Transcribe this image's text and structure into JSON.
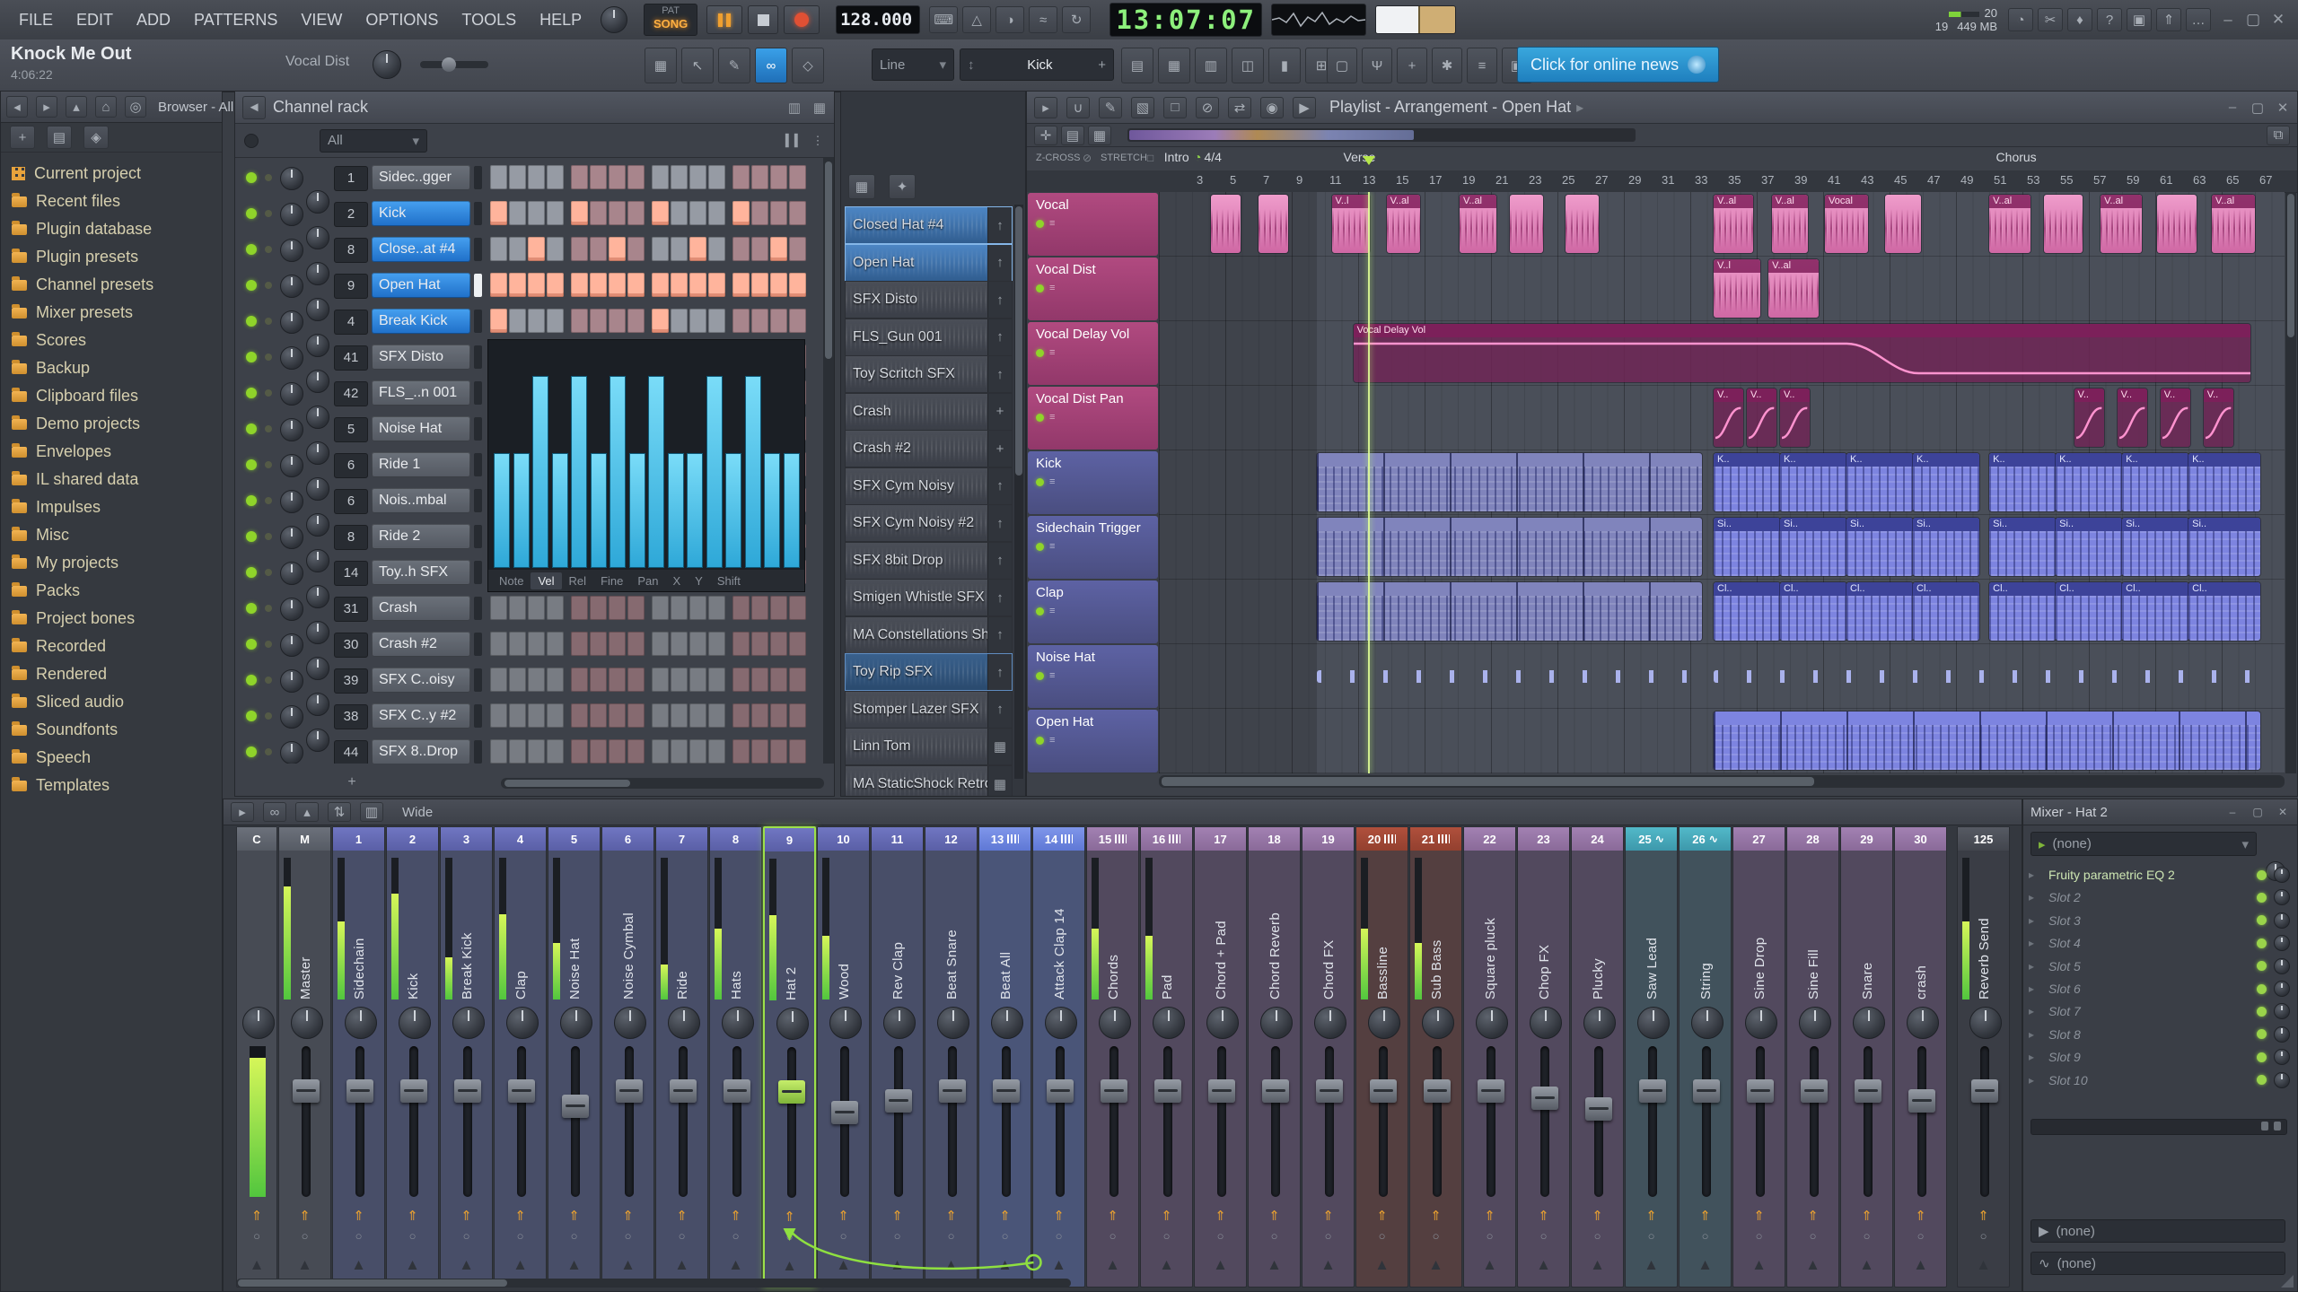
{
  "menubar": {
    "items": [
      "FILE",
      "EDIT",
      "ADD",
      "PATTERNS",
      "VIEW",
      "OPTIONS",
      "TOOLS",
      "HELP"
    ]
  },
  "transport": {
    "pat_label": "PAT",
    "song_label": "SONG",
    "tempo": "128.000",
    "time": "13:07:07",
    "cpu": "20",
    "memory": "449 MB",
    "voices": "19",
    "icons_left": [
      "typing-to-piano",
      "metronome",
      "wait",
      "blend",
      "overdub"
    ],
    "icons_right": [
      "time",
      "cut",
      "mic",
      "help",
      "save",
      "export",
      "chat"
    ]
  },
  "toolbar": {
    "project_title": "Knock Me Out",
    "project_length": "4:06:22",
    "focused_name": "Vocal Dist",
    "snap": "Line",
    "pattern": "Kick",
    "news": "Click for online news",
    "edit_icons": [
      "step-edit",
      "arrow",
      "pencil",
      "link",
      "remote"
    ],
    "view_icons": [
      "playlist",
      "piano-roll",
      "channel-rack",
      "browser-view",
      "mixer-view",
      "plugins"
    ],
    "tool_icons": [
      "clipboard",
      "splitter",
      "touch",
      "tools",
      "macro",
      "console"
    ]
  },
  "window": {
    "controls": [
      "minimize",
      "maximize",
      "close"
    ]
  },
  "browser": {
    "title": "Browser - All",
    "nav_icons": [
      "back",
      "forward",
      "up",
      "home",
      "search"
    ],
    "action_icons": [
      "add",
      "file",
      "autoplay"
    ],
    "items": [
      {
        "label": "Current project",
        "icon": "grid"
      },
      {
        "label": "Recent files",
        "icon": "folder"
      },
      {
        "label": "Plugin database",
        "icon": "folder"
      },
      {
        "label": "Plugin presets",
        "icon": "folder"
      },
      {
        "label": "Channel presets",
        "icon": "folder"
      },
      {
        "label": "Mixer presets",
        "icon": "folder"
      },
      {
        "label": "Scores",
        "icon": "folder"
      },
      {
        "label": "Backup",
        "icon": "folder"
      },
      {
        "label": "Clipboard files",
        "icon": "folder"
      },
      {
        "label": "Demo projects",
        "icon": "folder"
      },
      {
        "label": "Envelopes",
        "icon": "folder"
      },
      {
        "label": "IL shared data",
        "icon": "folder"
      },
      {
        "label": "Impulses",
        "icon": "folder"
      },
      {
        "label": "Misc",
        "icon": "folder"
      },
      {
        "label": "My projects",
        "icon": "folder"
      },
      {
        "label": "Packs",
        "icon": "folder"
      },
      {
        "label": "Project bones",
        "icon": "folder"
      },
      {
        "label": "Recorded",
        "icon": "folder"
      },
      {
        "label": "Rendered",
        "icon": "folder"
      },
      {
        "label": "Sliced audio",
        "icon": "folder"
      },
      {
        "label": "Soundfonts",
        "icon": "folder"
      },
      {
        "label": "Speech",
        "icon": "folder"
      },
      {
        "label": "Templates",
        "icon": "folder"
      }
    ]
  },
  "channel_rack": {
    "title": "Channel rack",
    "filter": "All",
    "graph_tabs": [
      "Note",
      "Vel",
      "Rel",
      "Fine",
      "Pan",
      "X",
      "Y",
      "Shift"
    ],
    "active_tab": "Vel",
    "graph_values": [
      55,
      55,
      92,
      55,
      92,
      55,
      92,
      55,
      92,
      55,
      55,
      92,
      55,
      92,
      55,
      55
    ],
    "channels": [
      {
        "num": "1",
        "name": "Sidec..gger",
        "style": "gray",
        "steps": "0000000000000000"
      },
      {
        "num": "2",
        "name": "Kick",
        "style": "blue",
        "steps": "1000100010001000"
      },
      {
        "num": "8",
        "name": "Close..at #4",
        "style": "blue",
        "steps": "0010001000100010"
      },
      {
        "num": "9",
        "name": "Open Hat",
        "style": "blue",
        "selected": true,
        "steps": "1111111111111111"
      },
      {
        "num": "4",
        "name": "Break Kick",
        "style": "blue",
        "steps": "1000000010000000"
      },
      {
        "num": "41",
        "name": "SFX Disto",
        "style": "gray",
        "steps": "0000000000000000"
      },
      {
        "num": "42",
        "name": "FLS_..n 001",
        "style": "gray",
        "steps": "0000000000000000"
      },
      {
        "num": "5",
        "name": "Noise Hat",
        "style": "gray",
        "steps": "0000000000000000"
      },
      {
        "num": "6",
        "name": "Ride 1",
        "style": "gray",
        "steps": "0000000000000000"
      },
      {
        "num": "6",
        "name": "Nois..mbal",
        "style": "gray",
        "steps": "0000000000000000"
      },
      {
        "num": "8",
        "name": "Ride 2",
        "style": "gray",
        "steps": "0000000000000000"
      },
      {
        "num": "14",
        "name": "Toy..h SFX",
        "style": "gray",
        "steps": "0000000000000000"
      },
      {
        "num": "31",
        "name": "Crash",
        "style": "gray",
        "dim": true,
        "steps": "0000000000000000"
      },
      {
        "num": "30",
        "name": "Crash #2",
        "style": "gray",
        "dim": true,
        "steps": "0000000000000000"
      },
      {
        "num": "39",
        "name": "SFX C..oisy",
        "style": "gray",
        "dim": true,
        "steps": "0000000000000000"
      },
      {
        "num": "38",
        "name": "SFX C..y #2",
        "style": "gray",
        "dim": true,
        "steps": "0000000000000000"
      },
      {
        "num": "44",
        "name": "SFX 8..Drop",
        "style": "gray",
        "dim": true,
        "steps": "0000000000000000"
      }
    ]
  },
  "picker": {
    "panel_icons": [
      "steps",
      "controls"
    ],
    "items": [
      {
        "name": "Closed Hat #4",
        "icon": "arrow",
        "state": "selected"
      },
      {
        "name": "Open Hat",
        "icon": "arrow",
        "state": "selected"
      },
      {
        "name": "SFX Disto",
        "icon": "arrow"
      },
      {
        "name": "FLS_Gun 001",
        "icon": "arrow"
      },
      {
        "name": "Toy Scritch SFX",
        "icon": "arrow"
      },
      {
        "name": "Crash",
        "icon": "move"
      },
      {
        "name": "Crash #2",
        "icon": "move"
      },
      {
        "name": "SFX Cym Noisy",
        "icon": "arrow"
      },
      {
        "name": "SFX Cym Noisy #2",
        "icon": "arrow"
      },
      {
        "name": "SFX 8bit Drop",
        "icon": "arrow"
      },
      {
        "name": "Smigen Whistle SFX",
        "icon": "arrow"
      },
      {
        "name": "MA Constellations Sh..",
        "icon": "arrow"
      },
      {
        "name": "Toy Rip SFX",
        "icon": "arrow",
        "state": "active"
      },
      {
        "name": "Stomper Lazer SFX",
        "icon": "arrow"
      },
      {
        "name": "Linn Tom",
        "icon": "grid"
      },
      {
        "name": "MA StaticShock Retro..",
        "icon": "grid"
      }
    ]
  },
  "playlist": {
    "title": "Playlist - Arrangement - Open Hat",
    "header_icons": [
      "collapse",
      "magnet",
      "pencil",
      "paint",
      "erase",
      "mute",
      "slip",
      "zoom",
      "playback"
    ],
    "zcross_label": "Z-CROSS",
    "stretch_label": "STRETCH",
    "markers": [
      {
        "label": "Intro",
        "bar": 1.2
      },
      {
        "label": "4/4",
        "bar": 3.0,
        "kind": "timesig"
      },
      {
        "label": "Verse",
        "bar": 12.0
      },
      {
        "label": "Chorus",
        "bar": 51.3
      }
    ],
    "bar_numbers": [
      3,
      5,
      7,
      9,
      11,
      13,
      15,
      17,
      19,
      21,
      23,
      25,
      27,
      29,
      31,
      33,
      35,
      37,
      39,
      41,
      43,
      45,
      47,
      49,
      51,
      53,
      55,
      57,
      59,
      61,
      63,
      65,
      67
    ],
    "playhead_bar": 13.5,
    "tracks": [
      {
        "name": "Vocal",
        "color": "pink"
      },
      {
        "name": "Vocal Dist",
        "color": "pink"
      },
      {
        "name": "Vocal Delay Vol",
        "color": "pink"
      },
      {
        "name": "Vocal Dist Pan",
        "color": "pink"
      },
      {
        "name": "Kick",
        "color": "blue"
      },
      {
        "name": "Sidechain Trigger",
        "color": "blue"
      },
      {
        "name": "Clap",
        "color": "blue"
      },
      {
        "name": "Noise Hat",
        "color": "blue"
      },
      {
        "name": "Open Hat",
        "color": "blue"
      }
    ],
    "clips": [
      {
        "t": 0,
        "b": 4.0,
        "l": 1.8,
        "k": "audio"
      },
      {
        "t": 0,
        "b": 6.9,
        "l": 1.8,
        "k": "audio"
      },
      {
        "t": 0,
        "b": 11.3,
        "l": 2.3,
        "k": "audio",
        "label": "V..l"
      },
      {
        "t": 0,
        "b": 14.6,
        "l": 2.0,
        "k": "audio",
        "label": "V..al"
      },
      {
        "t": 0,
        "b": 19.0,
        "l": 2.2,
        "k": "audio",
        "label": "V..al"
      },
      {
        "t": 0,
        "b": 22.0,
        "l": 2.0,
        "k": "audio"
      },
      {
        "t": 0,
        "b": 25.4,
        "l": 2.0,
        "k": "audio"
      },
      {
        "t": 0,
        "b": 34.3,
        "l": 2.4,
        "k": "audio",
        "label": "V..al"
      },
      {
        "t": 0,
        "b": 37.8,
        "l": 2.2,
        "k": "audio",
        "label": "V..al"
      },
      {
        "t": 0,
        "b": 41.0,
        "l": 2.6,
        "k": "audio",
        "label": "Vocal"
      },
      {
        "t": 0,
        "b": 44.6,
        "l": 2.2,
        "k": "audio"
      },
      {
        "t": 0,
        "b": 50.9,
        "l": 2.5,
        "k": "audio",
        "label": "V..al"
      },
      {
        "t": 0,
        "b": 54.2,
        "l": 2.3,
        "k": "audio"
      },
      {
        "t": 0,
        "b": 57.6,
        "l": 2.5,
        "k": "audio",
        "label": "V..al"
      },
      {
        "t": 0,
        "b": 61.0,
        "l": 2.4,
        "k": "audio"
      },
      {
        "t": 0,
        "b": 64.3,
        "l": 2.6,
        "k": "audio",
        "label": "V..al"
      },
      {
        "t": 1,
        "b": 34.3,
        "l": 2.8,
        "k": "audio",
        "label": "V..l"
      },
      {
        "t": 1,
        "b": 37.6,
        "l": 3.0,
        "k": "audio",
        "label": "V..al"
      },
      {
        "t": 2,
        "b": 12.6,
        "l": 54.0,
        "k": "autolong",
        "label": "Vocal Delay Vol"
      },
      {
        "t": 3,
        "b": 34.3,
        "l": 1.8,
        "k": "auto",
        "label": "V.."
      },
      {
        "t": 3,
        "b": 36.3,
        "l": 1.8,
        "k": "auto",
        "label": "V.."
      },
      {
        "t": 3,
        "b": 38.3,
        "l": 1.8,
        "k": "auto",
        "label": "V.."
      },
      {
        "t": 3,
        "b": 56.0,
        "l": 1.8,
        "k": "auto",
        "label": "V.."
      },
      {
        "t": 3,
        "b": 58.6,
        "l": 1.8,
        "k": "auto",
        "label": "V.."
      },
      {
        "t": 3,
        "b": 61.2,
        "l": 1.8,
        "k": "auto",
        "label": "V.."
      },
      {
        "t": 3,
        "b": 63.8,
        "l": 1.8,
        "k": "auto",
        "label": "V.."
      },
      {
        "t": 4,
        "b": 10.4,
        "l": 23.2,
        "k": "patdim"
      },
      {
        "t": 4,
        "b": 34.3,
        "l": 4,
        "k": "pat",
        "label": "K.."
      },
      {
        "t": 4,
        "b": 38.3,
        "l": 4,
        "k": "pat",
        "label": "K.."
      },
      {
        "t": 4,
        "b": 42.3,
        "l": 4,
        "k": "pat",
        "label": "K.."
      },
      {
        "t": 4,
        "b": 46.3,
        "l": 4,
        "k": "pat",
        "label": "K.."
      },
      {
        "t": 4,
        "b": 50.9,
        "l": 4,
        "k": "pat",
        "label": "K.."
      },
      {
        "t": 4,
        "b": 54.9,
        "l": 4,
        "k": "pat",
        "label": "K.."
      },
      {
        "t": 4,
        "b": 58.9,
        "l": 4,
        "k": "pat",
        "label": "K.."
      },
      {
        "t": 4,
        "b": 62.9,
        "l": 4.3,
        "k": "pat",
        "label": "K.."
      },
      {
        "t": 5,
        "b": 10.4,
        "l": 23.2,
        "k": "patdim"
      },
      {
        "t": 5,
        "b": 34.3,
        "l": 4,
        "k": "pat",
        "label": "Si.."
      },
      {
        "t": 5,
        "b": 38.3,
        "l": 4,
        "k": "pat",
        "label": "Si.."
      },
      {
        "t": 5,
        "b": 42.3,
        "l": 4,
        "k": "pat",
        "label": "Si.."
      },
      {
        "t": 5,
        "b": 46.3,
        "l": 4,
        "k": "pat",
        "label": "Si.."
      },
      {
        "t": 5,
        "b": 50.9,
        "l": 4,
        "k": "pat",
        "label": "Si.."
      },
      {
        "t": 5,
        "b": 54.9,
        "l": 4,
        "k": "pat",
        "label": "Si.."
      },
      {
        "t": 5,
        "b": 58.9,
        "l": 4,
        "k": "pat",
        "label": "Si.."
      },
      {
        "t": 5,
        "b": 62.9,
        "l": 4.3,
        "k": "pat",
        "label": "Si.."
      },
      {
        "t": 6,
        "b": 10.4,
        "l": 23.2,
        "k": "patdim"
      },
      {
        "t": 6,
        "b": 34.3,
        "l": 4,
        "k": "pat",
        "label": "Cl.."
      },
      {
        "t": 6,
        "b": 38.3,
        "l": 4,
        "k": "pat",
        "label": "Cl.."
      },
      {
        "t": 6,
        "b": 42.3,
        "l": 4,
        "k": "pat",
        "label": "Cl.."
      },
      {
        "t": 6,
        "b": 46.3,
        "l": 4,
        "k": "pat",
        "label": "Cl.."
      },
      {
        "t": 6,
        "b": 50.9,
        "l": 4,
        "k": "pat",
        "label": "Cl.."
      },
      {
        "t": 6,
        "b": 54.9,
        "l": 4,
        "k": "pat",
        "label": "Cl.."
      },
      {
        "t": 6,
        "b": 58.9,
        "l": 4,
        "k": "pat",
        "label": "Cl.."
      },
      {
        "t": 6,
        "b": 62.9,
        "l": 4.3,
        "k": "pat",
        "label": "Cl.."
      },
      {
        "t": 7,
        "b": 10.4,
        "l": 23.2,
        "k": "ticks"
      },
      {
        "t": 7,
        "b": 34.3,
        "l": 32.9,
        "k": "ticks"
      },
      {
        "t": 8,
        "b": 34.3,
        "l": 32.9,
        "k": "patlong"
      }
    ]
  },
  "mixer": {
    "mode": "Wide",
    "header_icons": [
      "collapse",
      "link",
      "up",
      "updown",
      "film"
    ],
    "strips": [
      {
        "num": "C",
        "name": "",
        "group": "plain",
        "mainMeter": 0.92
      },
      {
        "num": "M",
        "name": "Master",
        "group": "plain",
        "meter": 0.8
      },
      {
        "num": "1",
        "name": "Sidechain",
        "group": "indigo",
        "meter": 0.55
      },
      {
        "num": "2",
        "name": "Kick",
        "group": "indigo",
        "meter": 0.75
      },
      {
        "num": "3",
        "name": "Break Kick",
        "group": "indigo",
        "meter": 0.3
      },
      {
        "num": "4",
        "name": "Clap",
        "group": "indigo",
        "meter": 0.6
      },
      {
        "num": "5",
        "name": "Noise Hat",
        "group": "indigo",
        "meter": 0.4,
        "fader": 0.62
      },
      {
        "num": "6",
        "name": "Noise Cymbal",
        "group": "indigo"
      },
      {
        "num": "7",
        "name": "Ride",
        "group": "indigo",
        "meter": 0.25
      },
      {
        "num": "8",
        "name": "Hats",
        "group": "indigo",
        "meter": 0.5
      },
      {
        "num": "9",
        "name": "Hat 2",
        "group": "indigo",
        "selected": true,
        "meter": 0.6
      },
      {
        "num": "10",
        "name": "Wood",
        "group": "indigo",
        "meter": 0.45,
        "fader": 0.57
      },
      {
        "num": "11",
        "name": "Rev Clap",
        "group": "indigo",
        "fader": 0.66
      },
      {
        "num": "12",
        "name": "Beat Snare",
        "group": "indigo"
      },
      {
        "num": "13",
        "name": "Beat All",
        "group": "indigoBright",
        "icon": "w"
      },
      {
        "num": "14",
        "name": "Attack Clap 14",
        "group": "indigoBright",
        "icon": "w"
      },
      {
        "num": "15",
        "name": "Chords",
        "group": "mauve",
        "icon": "w",
        "meter": 0.5
      },
      {
        "num": "16",
        "name": "Pad",
        "group": "mauve",
        "icon": "w",
        "meter": 0.45
      },
      {
        "num": "17",
        "name": "Chord + Pad",
        "group": "mauve"
      },
      {
        "num": "18",
        "name": "Chord Reverb",
        "group": "mauve"
      },
      {
        "num": "19",
        "name": "Chord FX",
        "group": "mauve"
      },
      {
        "num": "20",
        "name": "Bassline",
        "group": "red",
        "icon": "w",
        "meter": 0.5
      },
      {
        "num": "21",
        "name": "Sub Bass",
        "group": "red",
        "icon": "w",
        "meter": 0.4
      },
      {
        "num": "22",
        "name": "Square pluck",
        "group": "mauve"
      },
      {
        "num": "23",
        "name": "Chop FX",
        "group": "mauve",
        "fader": 0.68
      },
      {
        "num": "24",
        "name": "Plucky",
        "group": "mauve",
        "fader": 0.6
      },
      {
        "num": "25",
        "name": "Saw Lead",
        "group": "teal",
        "icon": "sine"
      },
      {
        "num": "26",
        "name": "String",
        "group": "teal",
        "icon": "sine"
      },
      {
        "num": "27",
        "name": "Sine Drop",
        "group": "mauve"
      },
      {
        "num": "28",
        "name": "Sine Fill",
        "group": "mauve"
      },
      {
        "num": "29",
        "name": "Snare",
        "group": "mauve"
      },
      {
        "num": "30",
        "name": "crash",
        "group": "mauve",
        "fader": 0.66
      },
      {
        "num": "125",
        "name": "Reverb Send",
        "group": "dark",
        "gap": true,
        "meter": 0.55
      }
    ]
  },
  "fx_panel": {
    "title": "Mixer - Hat 2",
    "slot_selector": "(none)",
    "slots": [
      {
        "label": "Fruity parametric EQ 2",
        "filled": true
      },
      {
        "label": "Slot 2"
      },
      {
        "label": "Slot 3"
      },
      {
        "label": "Slot 4"
      },
      {
        "label": "Slot 5"
      },
      {
        "label": "Slot 6"
      },
      {
        "label": "Slot 7"
      },
      {
        "label": "Slot 8"
      },
      {
        "label": "Slot 9"
      },
      {
        "label": "Slot 10"
      }
    ],
    "send_a": "(none)",
    "send_b": "(none)"
  }
}
